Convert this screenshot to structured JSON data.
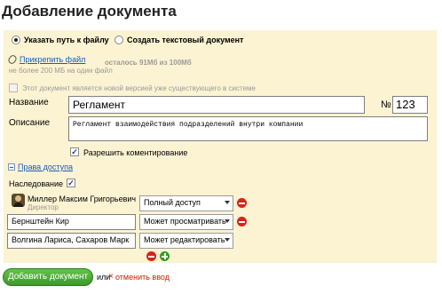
{
  "page": {
    "title": "Добавление документа"
  },
  "source": {
    "option_file": "Указать путь к файлу",
    "option_text": "Создать текстовый документ",
    "selected": "file"
  },
  "attach": {
    "link": "Прикрепить файл",
    "limit_note": "не более 200 МБ на один файл",
    "quota": "осталось 91Мб из 100Мб"
  },
  "new_version": {
    "label": "Этот документ является новой версией уже существующего в системе",
    "checked": false
  },
  "fields": {
    "name_label": "Название",
    "name_value": "Регламент",
    "number_label": "№",
    "number_value": "123",
    "desc_label": "Описание",
    "desc_value": "Регламент взаимодействия подразделений внутри компании"
  },
  "comments": {
    "label": "Разрешить коментирование",
    "checked": true
  },
  "access": {
    "link": "Права доступа",
    "inherit_label": "Наследование",
    "inherit_checked": true,
    "owner": {
      "name": "Миллер Максим Григорьевич",
      "role": "Директор",
      "permission": "Полный доступ"
    },
    "rows": [
      {
        "name": "Бернштейн Кир",
        "permission": "Может просматривать"
      },
      {
        "name": "Волгина Лариса, Сахаров Марк",
        "permission": "Может редактировать"
      }
    ]
  },
  "actions": {
    "submit": "Добавить документ",
    "or": "или",
    "cancel_mark": "×",
    "cancel": "отменить ввод"
  },
  "colors": {
    "panel_bg": "#fbf3d2",
    "link": "#1a5fb4",
    "cancel": "#cc2200",
    "submit_green": "#3c9a29"
  }
}
